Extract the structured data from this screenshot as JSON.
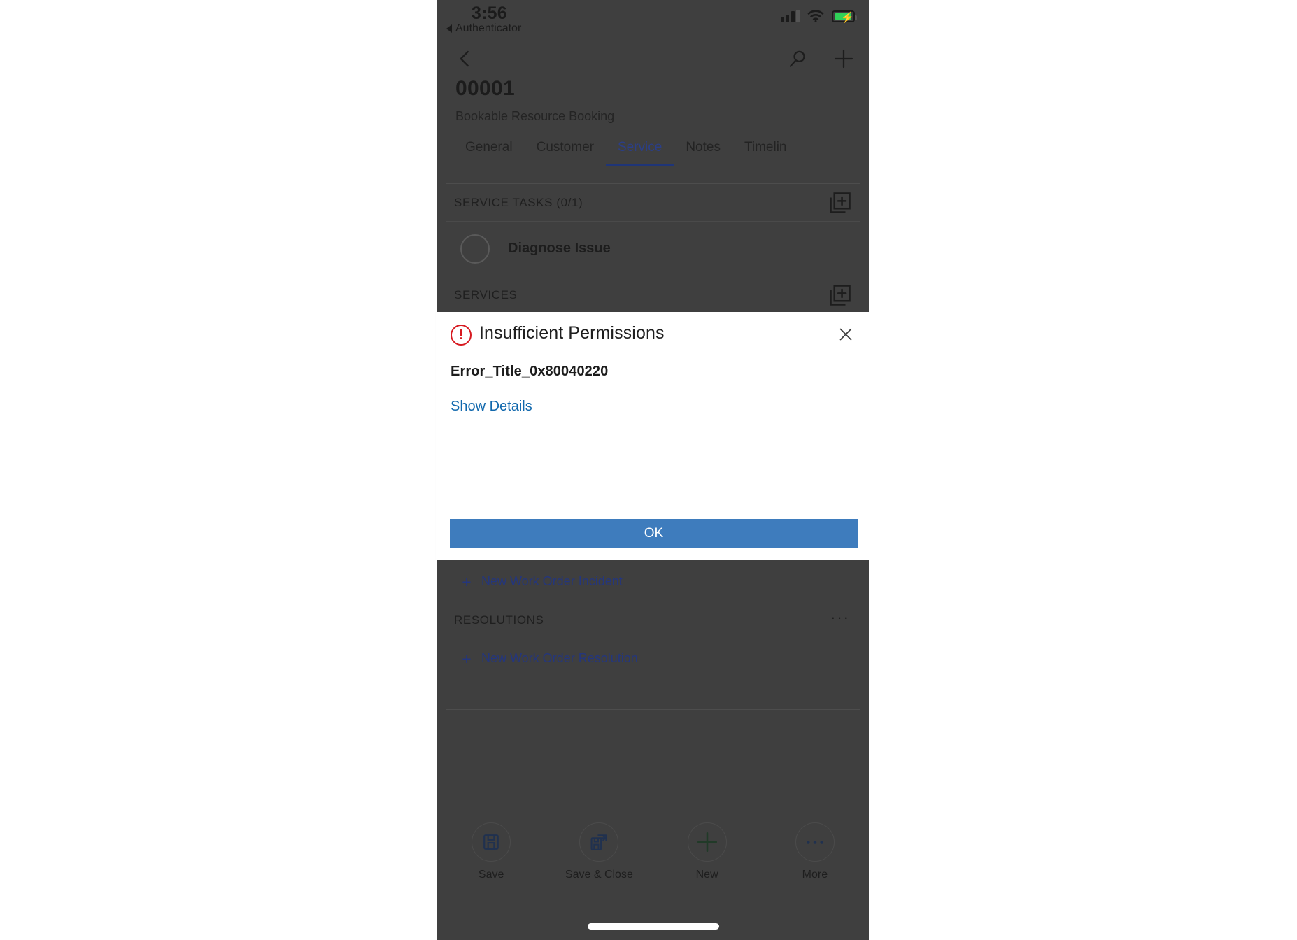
{
  "statusbar": {
    "time": "3:56",
    "back_app": "Authenticator",
    "signal_icon": "cellular-signal-icon",
    "wifi_icon": "wifi-icon",
    "battery_icon": "battery-charging-icon"
  },
  "navbar": {
    "back_icon": "chevron-left-icon",
    "search_icon": "search-icon",
    "add_icon": "plus-icon"
  },
  "record": {
    "title": "00001",
    "subtitle": "Bookable Resource Booking"
  },
  "tabs": [
    {
      "label": "General",
      "active": false
    },
    {
      "label": "Customer",
      "active": false
    },
    {
      "label": "Service",
      "active": true
    },
    {
      "label": "Notes",
      "active": false
    },
    {
      "label": "Timelin",
      "active": false
    }
  ],
  "sections": {
    "service_tasks": {
      "header": "SERVICE TASKS (0/1)",
      "add_icon": "add-new-record-icon",
      "rows": [
        {
          "label": "Diagnose Issue",
          "checkbox_icon": "circle-unchecked-icon"
        }
      ]
    },
    "services": {
      "header": "SERVICES",
      "add_icon": "add-new-record-icon"
    },
    "incidents": {
      "new_link": "New Work Order Incident",
      "plus_icon": "plus-icon"
    },
    "resolutions": {
      "header": "RESOLUTIONS",
      "more_icon": "ellipsis-icon",
      "new_link": "New Work Order Resolution",
      "plus_icon": "plus-icon"
    }
  },
  "dialog": {
    "title": "Insufficient Permissions",
    "alert_icon": "exclamation-circle-icon",
    "alert_color": "#d71920",
    "close_icon": "close-icon",
    "error_code": "Error_Title_0x80040220",
    "details_link": "Show Details",
    "ok_label": "OK",
    "ok_color": "#3e7cbd",
    "link_color": "#1168ad"
  },
  "commandbar": [
    {
      "label": "Save",
      "icon": "save-floppy-icon"
    },
    {
      "label": "Save & Close",
      "icon": "save-and-close-icon"
    },
    {
      "label": "New",
      "icon": "plus-icon"
    },
    {
      "label": "More",
      "icon": "ellipsis-icon"
    }
  ]
}
